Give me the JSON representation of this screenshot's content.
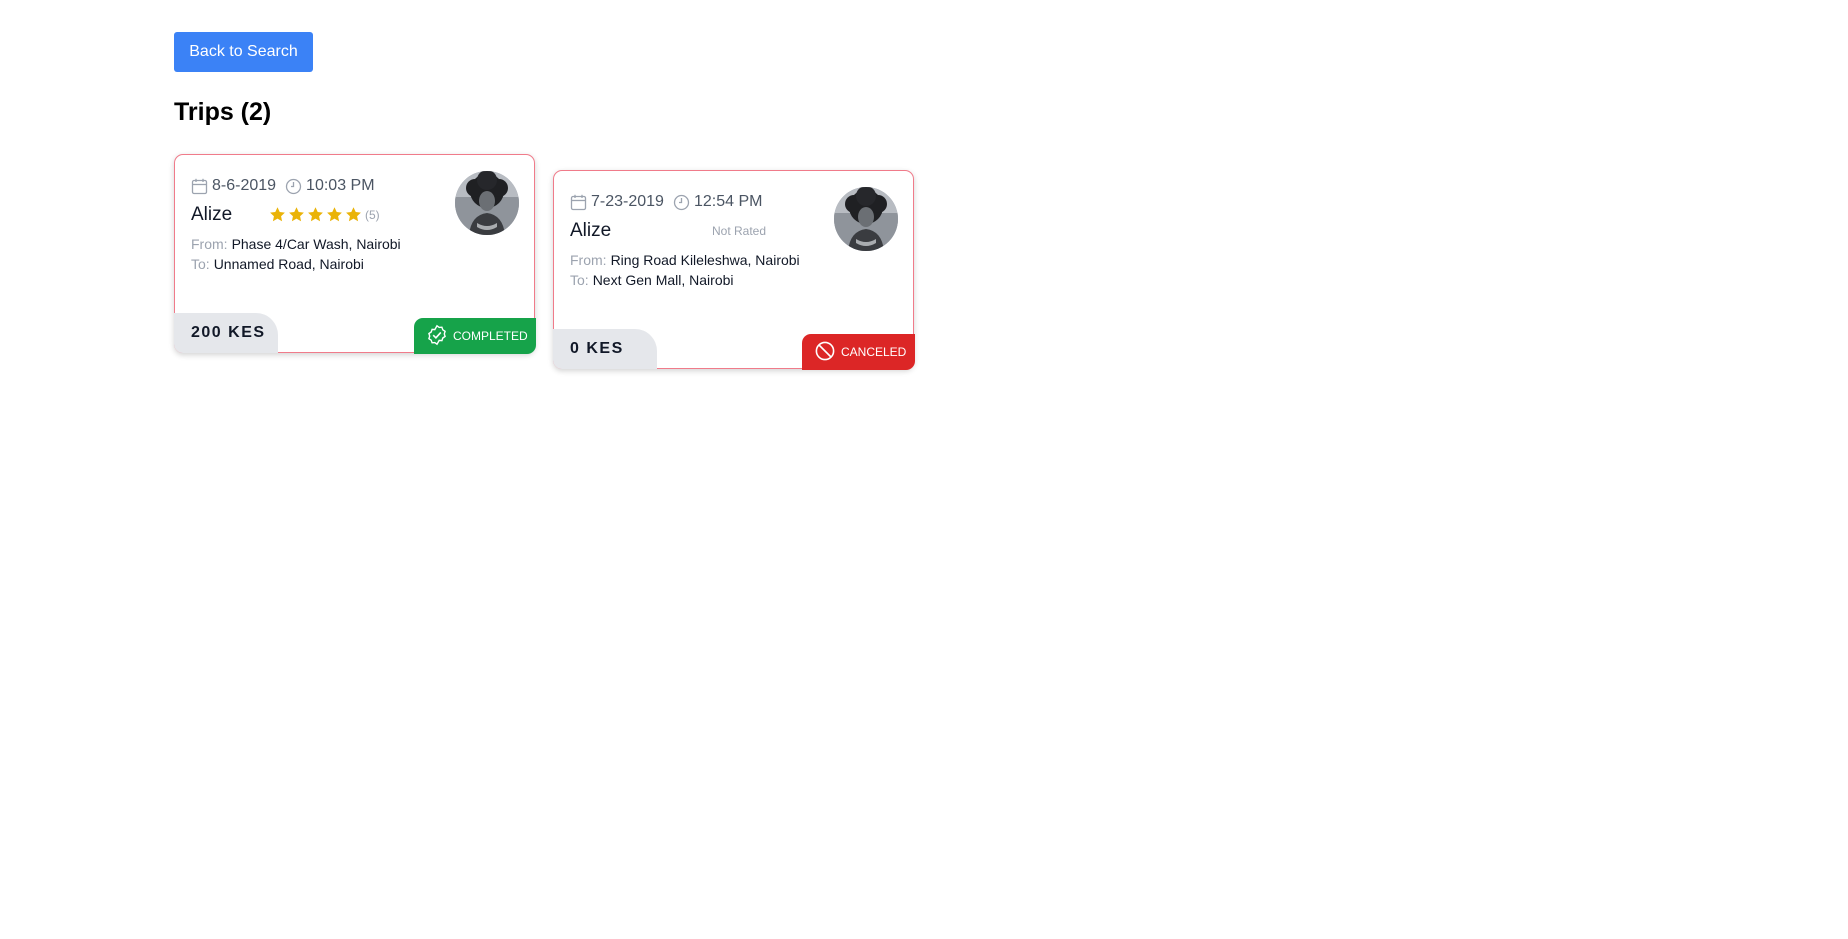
{
  "header": {
    "back_button_label": "Back to Search",
    "title": "Trips (2)"
  },
  "trips": [
    {
      "date": "8-6-2019",
      "time": "10:03 PM",
      "driver": "Alize",
      "rating_stars": 5,
      "rating_count": "(5)",
      "from_label": "From:",
      "from": "Phase 4/Car Wash, Nairobi",
      "to_label": "To:",
      "to": "Unnamed Road, Nairobi",
      "fare": "200 KES",
      "status": "COMPLETED",
      "status_color": "#16a34a",
      "status_icon": "check-badge-icon"
    },
    {
      "date": "7-23-2019",
      "time": "12:54 PM",
      "driver": "Alize",
      "rating_text": "Not Rated",
      "from_label": "From:",
      "from": "Ring Road Kileleshwa, Nairobi",
      "to_label": "To:",
      "to": "Next Gen Mall, Nairobi",
      "fare": "0 KES",
      "status": "CANCELED",
      "status_color": "#dc2626",
      "status_icon": "ban-icon"
    }
  ],
  "colors": {
    "primary": "#3b82f6",
    "card_border": "#f07b8a",
    "star": "#eab308"
  }
}
